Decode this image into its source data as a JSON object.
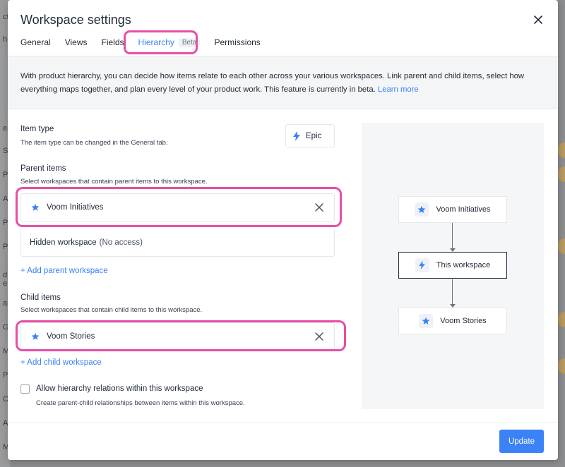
{
  "modal": {
    "title": "Workspace settings"
  },
  "tabs": [
    {
      "label": "General"
    },
    {
      "label": "Views"
    },
    {
      "label": "Fields"
    },
    {
      "label": "Hierarchy",
      "badge": "Beta"
    },
    {
      "label": "Permissions"
    }
  ],
  "info": {
    "text": "With product hierarchy, you can decide how items relate to each other across your various workspaces. Link parent and child items, select how everything maps together, and plan every level of your product work. This feature is currently in beta.",
    "link": "Learn more"
  },
  "item_type": {
    "title": "Item type",
    "subtitle": "The item type can be changed in the General tab.",
    "value": "Epic"
  },
  "parent_items": {
    "title": "Parent items",
    "subtitle": "Select workspaces that contain parent items to this workspace.",
    "selected": "Voom Initiatives",
    "hidden_label": "Hidden workspace",
    "hidden_note": "(No access)",
    "add_link": "+ Add parent workspace"
  },
  "child_items": {
    "title": "Child items",
    "subtitle": "Select workspaces that contain child items to this workspace.",
    "selected": "Voom Stories",
    "add_link": "+ Add child workspace"
  },
  "allow_relations": {
    "label": "Allow hierarchy relations within this workspace",
    "description": "Create parent-child relationships between items within this workspace.",
    "checked": false
  },
  "diagram": {
    "nodes": [
      {
        "label": "Voom Initiatives",
        "icon": "star-icon"
      },
      {
        "label": "This workspace",
        "icon": "lightning-icon"
      },
      {
        "label": "Voom Stories",
        "icon": "star-icon"
      }
    ]
  },
  "footer": {
    "update_label": "Update"
  },
  "colors": {
    "accent": "#3b82f6",
    "highlight": "#e84ea6"
  },
  "background": {
    "left_labels": [
      "ct",
      "h",
      "ea",
      "S",
      "P",
      "A",
      "P",
      "P",
      "d e",
      "an",
      "G",
      "M",
      "P",
      "C",
      "A",
      "M"
    ]
  }
}
